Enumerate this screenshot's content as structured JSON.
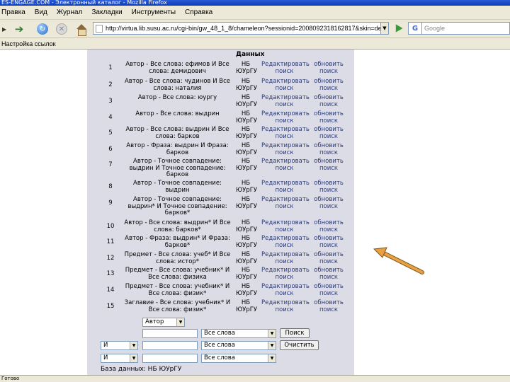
{
  "window": {
    "title": "ES-ENGAGE.COM - Электронный каталог - Mozilla Firefox"
  },
  "menu": [
    "Правка",
    "Вид",
    "Журнал",
    "Закладки",
    "Инструменты",
    "Справка"
  ],
  "nav": {
    "url": "http://virtua.lib.susu.ac.ru/cgi-bin/gw_48_1_8/chameleon?sessionid=2008092318162817&skin=defaul",
    "search_placeholder": "Google",
    "search_engine_letter": "G"
  },
  "bookmarks_bar": {
    "label": "Настройка ссылок"
  },
  "results": {
    "header": "Данных",
    "rows": [
      {
        "num": "1",
        "query": "Автор - Все слова: ефимов И Все слова: демидович",
        "db": "НБ ЮУрГУ",
        "edit": "Редактировать поиск",
        "update": "обновить поиск"
      },
      {
        "num": "2",
        "query": "Автор - Все слова: чудинов И Все слова: наталия",
        "db": "НБ ЮУрГУ",
        "edit": "Редактировать поиск",
        "update": "обновить поиск"
      },
      {
        "num": "3",
        "query": "Автор - Все слова: юургу",
        "db": "НБ ЮУрГУ",
        "edit": "Редактировать поиск",
        "update": "обновить поиск"
      },
      {
        "num": "4",
        "query": "Автор - Все слова: выдрин",
        "db": "НБ ЮУрГУ",
        "edit": "Редактировать поиск",
        "update": "обновить поиск"
      },
      {
        "num": "5",
        "query": "Автор - Все слова: выдрин И Все слова: барков",
        "db": "НБ ЮУрГУ",
        "edit": "Редактировать поиск",
        "update": "обновить поиск"
      },
      {
        "num": "6",
        "query": "Автор - Фраза: выдрин И Фраза: барков",
        "db": "НБ ЮУрГУ",
        "edit": "Редактировать поиск",
        "update": "обновить поиск"
      },
      {
        "num": "7",
        "query": "Автор - Точное совпадение: выдрин И Точное совпадение: барков",
        "db": "НБ ЮУрГУ",
        "edit": "Редактировать поиск",
        "update": "обновить поиск"
      },
      {
        "num": "8",
        "query": "Автор - Точное совпадение: выдрин",
        "db": "НБ ЮУрГУ",
        "edit": "Редактировать поиск",
        "update": "обновить поиск"
      },
      {
        "num": "9",
        "query": "Автор - Точное совпадение: выдрин* И Точное совпадение: барков*",
        "db": "НБ ЮУрГУ",
        "edit": "Редактировать поиск",
        "update": "обновить поиск"
      },
      {
        "num": "10",
        "query": "Автор - Все слова: выдрин* И Все слова: барков*",
        "db": "НБ ЮУрГУ",
        "edit": "Редактировать поиск",
        "update": "обновить поиск"
      },
      {
        "num": "11",
        "query": "Автор - Фраза: выдрин* И Фраза: барков*",
        "db": "НБ ЮУрГУ",
        "edit": "Редактировать поиск",
        "update": "обновить поиск"
      },
      {
        "num": "12",
        "query": "Предмет - Все слова: учеб* И Все слова: истор*",
        "db": "НБ ЮУрГУ",
        "edit": "Редактировать поиск",
        "update": "обновить поиск"
      },
      {
        "num": "13",
        "query": "Предмет - Все слова: учебник* И Все слова: физика",
        "db": "НБ ЮУрГУ",
        "edit": "Редактировать поиск",
        "update": "обновить поиск"
      },
      {
        "num": "14",
        "query": "Предмет - Все слова: учебник* И Все слова: физик*",
        "db": "НБ ЮУрГУ",
        "edit": "Редактировать поиск",
        "update": "обновить поиск"
      },
      {
        "num": "15",
        "query": "Заглавие - Все слова: учебник* И Все слова: физик*",
        "db": "НБ ЮУрГУ",
        "edit": "Редактировать поиск",
        "update": "обновить поиск"
      }
    ]
  },
  "form": {
    "field_select": "Автор",
    "mode_select_1": "Все слова",
    "mode_select_2": "Все слова",
    "mode_select_3": "Все слова",
    "bool_select_2": "И",
    "bool_select_3": "И",
    "search_button": "Поиск",
    "clear_button": "Очистить",
    "db_footer": "База данных: НБ ЮУрГУ"
  },
  "status": {
    "text": "Готово"
  },
  "annotation": {
    "arrow_color": "#e8a040"
  }
}
